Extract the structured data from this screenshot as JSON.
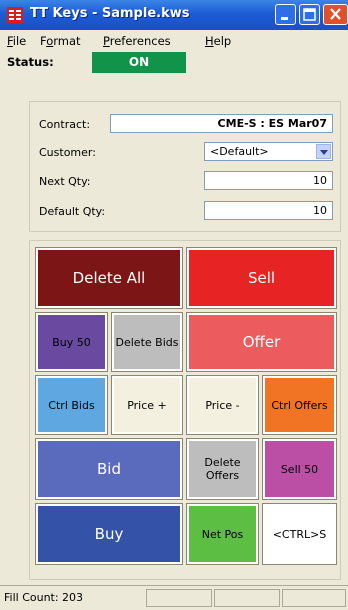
{
  "window": {
    "title": "TT Keys - Sample.kws"
  },
  "menu": {
    "file": {
      "first": "F",
      "rest": "ile"
    },
    "format": {
      "first": "F",
      "u": "o",
      "rest": "rmat"
    },
    "preferences": {
      "first": "P",
      "rest": "references"
    },
    "help": {
      "first": "H",
      "rest": "elp"
    }
  },
  "status": {
    "label": "Status:",
    "value": "ON"
  },
  "fields": {
    "contract": {
      "label": "Contract:",
      "value": "CME-S : ES Mar07"
    },
    "customer": {
      "label": "Customer:",
      "value": "<Default>"
    },
    "next_qty": {
      "label": "Next Qty:",
      "value": "10"
    },
    "default_qty": {
      "label": "Default Qty:",
      "value": "10"
    }
  },
  "keys": {
    "delete_all": "Delete All",
    "sell": "Sell",
    "buy50": "Buy 50",
    "delete_bids": "Delete Bids",
    "offer": "Offer",
    "ctrl_bids": "Ctrl Bids",
    "price_plus": "Price +",
    "price_minus": "Price -",
    "ctrl_offers": "Ctrl Offers",
    "bid": "Bid",
    "delete_offers": "Delete Offers",
    "sell50": "Sell 50",
    "buy": "Buy",
    "net_pos": "Net Pos",
    "ctrl_s": "<CTRL>S"
  },
  "statusbar": {
    "fill_count": "Fill Count: 203"
  },
  "colors": {
    "status_on": "#119449",
    "delete_all": "#7c1515",
    "sell": "#e82323",
    "buy50": "#6a4aa1",
    "delete_gray": "#bdbdbd",
    "offer": "#ec5c5e",
    "ctrl_bids": "#5fa7e0",
    "price": "#f3f0df",
    "ctrl_offers": "#f17424",
    "bid": "#5a6bbd",
    "sell50": "#bb4fa6",
    "buy": "#3453a8",
    "net_pos": "#5cbf43",
    "ctrl_s": "#ffffff"
  }
}
